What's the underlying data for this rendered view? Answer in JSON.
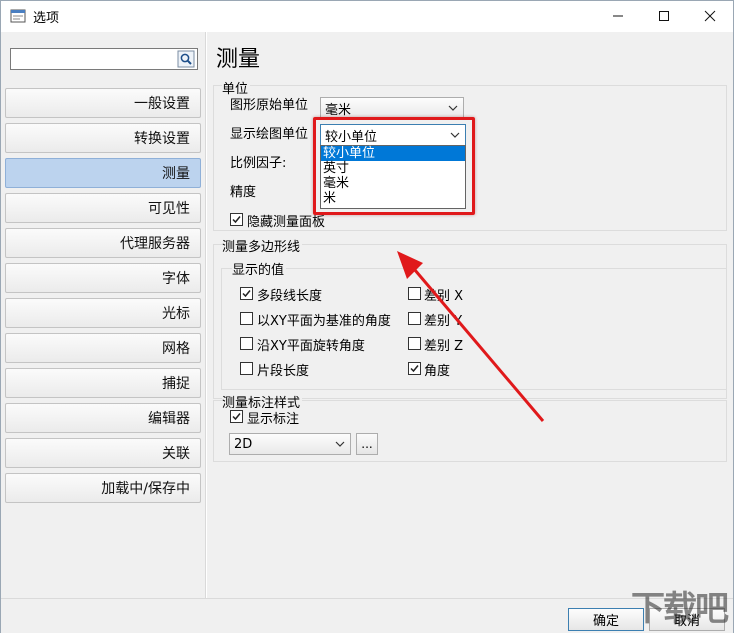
{
  "window": {
    "title": "选项",
    "controls": {
      "minimize": "—",
      "maximize": "☐",
      "close": "✕"
    }
  },
  "sidebar": {
    "search": {
      "value": "",
      "placeholder": ""
    },
    "items": [
      {
        "label": "一般设置",
        "active": false
      },
      {
        "label": "转换设置",
        "active": false
      },
      {
        "label": "测量",
        "active": true
      },
      {
        "label": "可见性",
        "active": false
      },
      {
        "label": "代理服务器",
        "active": false
      },
      {
        "label": "字体",
        "active": false
      },
      {
        "label": "光标",
        "active": false
      },
      {
        "label": "网格",
        "active": false
      },
      {
        "label": "捕捉",
        "active": false
      },
      {
        "label": "编辑器",
        "active": false
      },
      {
        "label": "关联",
        "active": false
      },
      {
        "label": "加载中/保存中",
        "active": false
      }
    ]
  },
  "main": {
    "title": "测量",
    "units_group": {
      "title": "单位",
      "drawing_unit_label": "图形原始单位",
      "drawing_unit_value": "毫米",
      "display_unit_label": "显示绘图单位",
      "display_unit_value": "较小单位",
      "scale_label": "比例因子:",
      "precision_label": "精度",
      "hide_panel_label": "隐藏测量面板",
      "hide_panel_checked": true,
      "dropdown_options": [
        "较小单位",
        "英寸",
        "毫米",
        "米"
      ],
      "dropdown_selected_index": 0
    },
    "polygon_group": {
      "title": "测量多边形线",
      "display_values_title": "显示的值",
      "options": [
        {
          "label": "多段线长度",
          "checked": true
        },
        {
          "label": "差别 X",
          "checked": false
        },
        {
          "label": "以XY平面为基准的角度",
          "checked": false
        },
        {
          "label": "差别 Y",
          "checked": false
        },
        {
          "label": "沿XY平面旋转角度",
          "checked": false
        },
        {
          "label": "差别 Z",
          "checked": false
        },
        {
          "label": "片段长度",
          "checked": false
        },
        {
          "label": "角度",
          "checked": true
        }
      ]
    },
    "annotation_group": {
      "title": "测量标注样式",
      "show_label": "显示标注",
      "show_checked": true,
      "style_value": "2D",
      "more_button": "..."
    }
  },
  "footer": {
    "ok": "确定",
    "cancel": "取消"
  },
  "watermark": "下载吧",
  "colors": {
    "highlight": "#e0191b",
    "selection": "#0078d7",
    "active_nav": "#bcd3ee"
  }
}
